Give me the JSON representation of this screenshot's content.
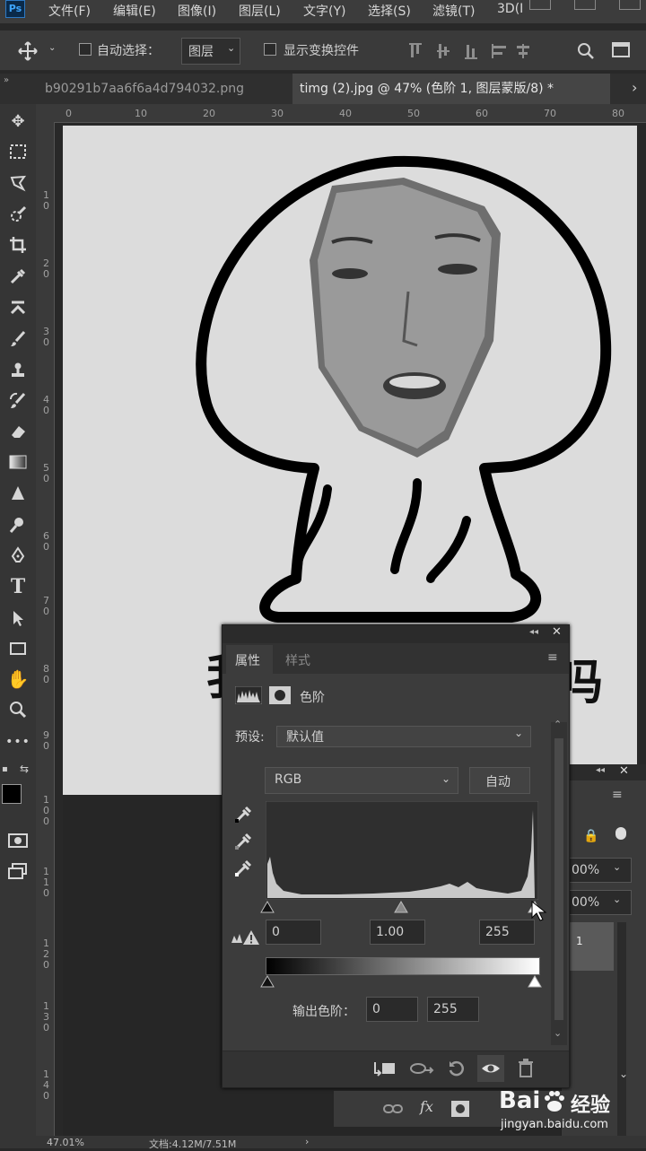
{
  "app": {
    "logo": "Ps"
  },
  "menu": [
    "文件(F)",
    "编辑(E)",
    "图像(I)",
    "图层(L)",
    "文字(Y)",
    "选择(S)",
    "滤镜(T)",
    "3D(I"
  ],
  "options": {
    "auto_select_label": "自动选择：",
    "auto_select_value": "图层",
    "show_transform_label": "显示变换控件"
  },
  "tabs": [
    {
      "label": "b90291b7aa6f6a4d794032.png",
      "active": false
    },
    {
      "label": "timg (2).jpg @ 47% (色阶 1, 图层蒙版/8) *",
      "active": true
    }
  ],
  "tools": [
    "move-icon",
    "marquee-icon",
    "lasso-icon",
    "quick-select-icon",
    "crop-icon",
    "eyedropper-icon",
    "healing-icon",
    "brush-icon",
    "stamp-icon",
    "history-brush-icon",
    "eraser-icon",
    "gradient-icon",
    "sharpen-icon",
    "dodge-icon",
    "pen-icon",
    "type-icon",
    "path-select-icon",
    "rectangle-icon",
    "hand-icon",
    "zoom-icon",
    "more-icon"
  ],
  "ruler": {
    "h": [
      "0",
      "10",
      "20",
      "30",
      "40",
      "50",
      "60",
      "70",
      "80"
    ],
    "v": [
      "1\n0",
      "2\n0",
      "3\n0",
      "4\n0",
      "5\n0",
      "6\n0",
      "7\n0",
      "8\n0",
      "9\n0",
      "1\n0\n0",
      "1\n1\n0",
      "1\n2\n0",
      "1\n3\n0",
      "1\n4\n0"
    ]
  },
  "canvas": {
    "text_left": "我",
    "text_right": "吗"
  },
  "properties": {
    "tab_properties": "属性",
    "tab_styles": "样式",
    "adjustment_name": "色阶",
    "preset_label": "预设:",
    "preset_value": "默认值",
    "channel_value": "RGB",
    "auto_button": "自动",
    "input_black": "0",
    "input_gamma": "1.00",
    "input_white": "255",
    "output_label": "输出色阶：",
    "output_black": "0",
    "output_white": "255"
  },
  "layers": {
    "opacity": "00%",
    "fill": "00%",
    "layer_num": "1"
  },
  "status": {
    "zoom": "47.01%",
    "doc": "文档:4.12M/7.51M"
  },
  "watermark": {
    "brand": "Bai",
    "brand2": "经验",
    "url": "jingyan.baidu.com"
  }
}
